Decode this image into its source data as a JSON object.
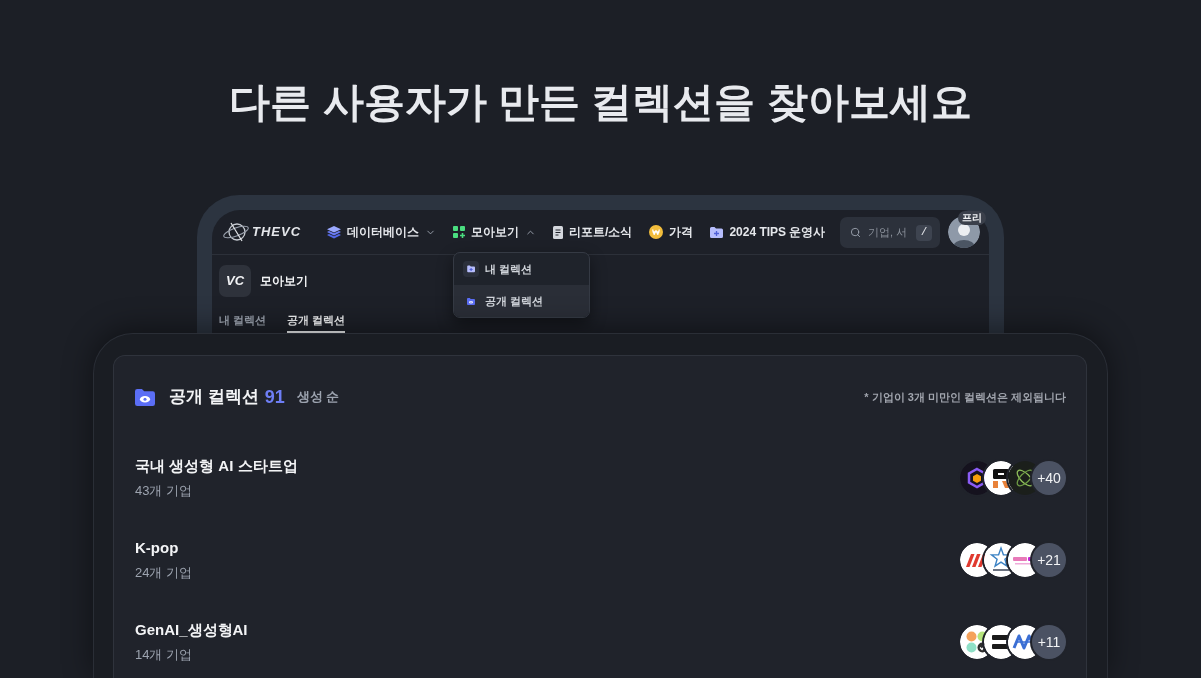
{
  "headline": "다른 사용자가 만든 컬렉션을 찾아보세요",
  "app_window": {
    "logo": "THEVC",
    "nav": [
      {
        "kind": "layers",
        "label": "데이터베이스",
        "expanded": false
      },
      {
        "kind": "grid",
        "label": "모아보기",
        "expanded": true
      },
      {
        "kind": "document",
        "label": "리포트/소식"
      },
      {
        "kind": "coin",
        "label": "가격"
      },
      {
        "kind": "folder",
        "label": "2024 TIPS 운영사"
      }
    ],
    "search": {
      "placeholder": "기업, 서",
      "shortcut": "/"
    },
    "profile": {
      "badge": "프리"
    },
    "dropdown": [
      {
        "kind": "folder-plus",
        "label": "내 컬렉션",
        "selected": false
      },
      {
        "kind": "folder-eye",
        "label": "공개 컬렉션",
        "selected": true
      }
    ],
    "page_header": {
      "logo": "VC",
      "title": "모아보기"
    },
    "tabs": [
      {
        "label": "내 컬렉션",
        "selected": false
      },
      {
        "label": "공개 컬렉션",
        "selected": true
      }
    ]
  },
  "collections": {
    "title": "공개 컬렉션",
    "count": "91",
    "sort": "생성 순",
    "note": "* 기업이 3개 미만인 컬렉션은 제외됩니다",
    "items": [
      {
        "name": "국내 생성형 AI 스타트업",
        "companies": "43개 기업",
        "logos": [
          {
            "kind": "hexagon"
          },
          {
            "kind": "block"
          },
          {
            "kind": "swirl"
          }
        ],
        "more": "+40"
      },
      {
        "name": "K-pop",
        "companies": "24개 기업",
        "logos": [
          {
            "kind": "slash"
          },
          {
            "kind": "star"
          },
          {
            "kind": "wordmark"
          }
        ],
        "more": "+21"
      },
      {
        "name": "GenAI_생성형AI",
        "companies": "14개 기업",
        "logos": [
          {
            "kind": "dots"
          },
          {
            "kind": "bars"
          },
          {
            "kind": "zigzag"
          }
        ],
        "more": "+11"
      }
    ]
  }
}
